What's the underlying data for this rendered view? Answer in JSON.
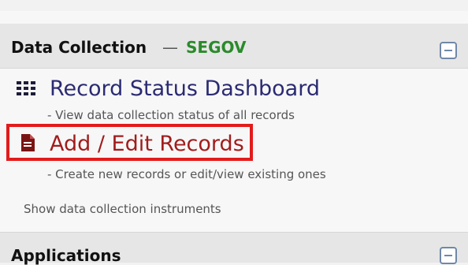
{
  "section": {
    "title": "Data Collection",
    "separator": "—",
    "project": "SEGOV"
  },
  "links": {
    "record_status": {
      "label": "Record Status Dashboard",
      "description": "- View data collection status of all records"
    },
    "add_edit": {
      "label": "Add / Edit Records",
      "description": "- Create new records or edit/view existing ones"
    },
    "show_instruments": "Show data collection instruments"
  },
  "applications": {
    "title": "Applications"
  },
  "colors": {
    "project_green": "#2b8a2b",
    "record_link": "#2b2a72",
    "add_link": "#a11c1c",
    "highlight": "#e31b1b"
  },
  "icons": {
    "record_status": "grid-icon",
    "add_edit": "document-icon",
    "collapse": "minus-square-icon"
  }
}
